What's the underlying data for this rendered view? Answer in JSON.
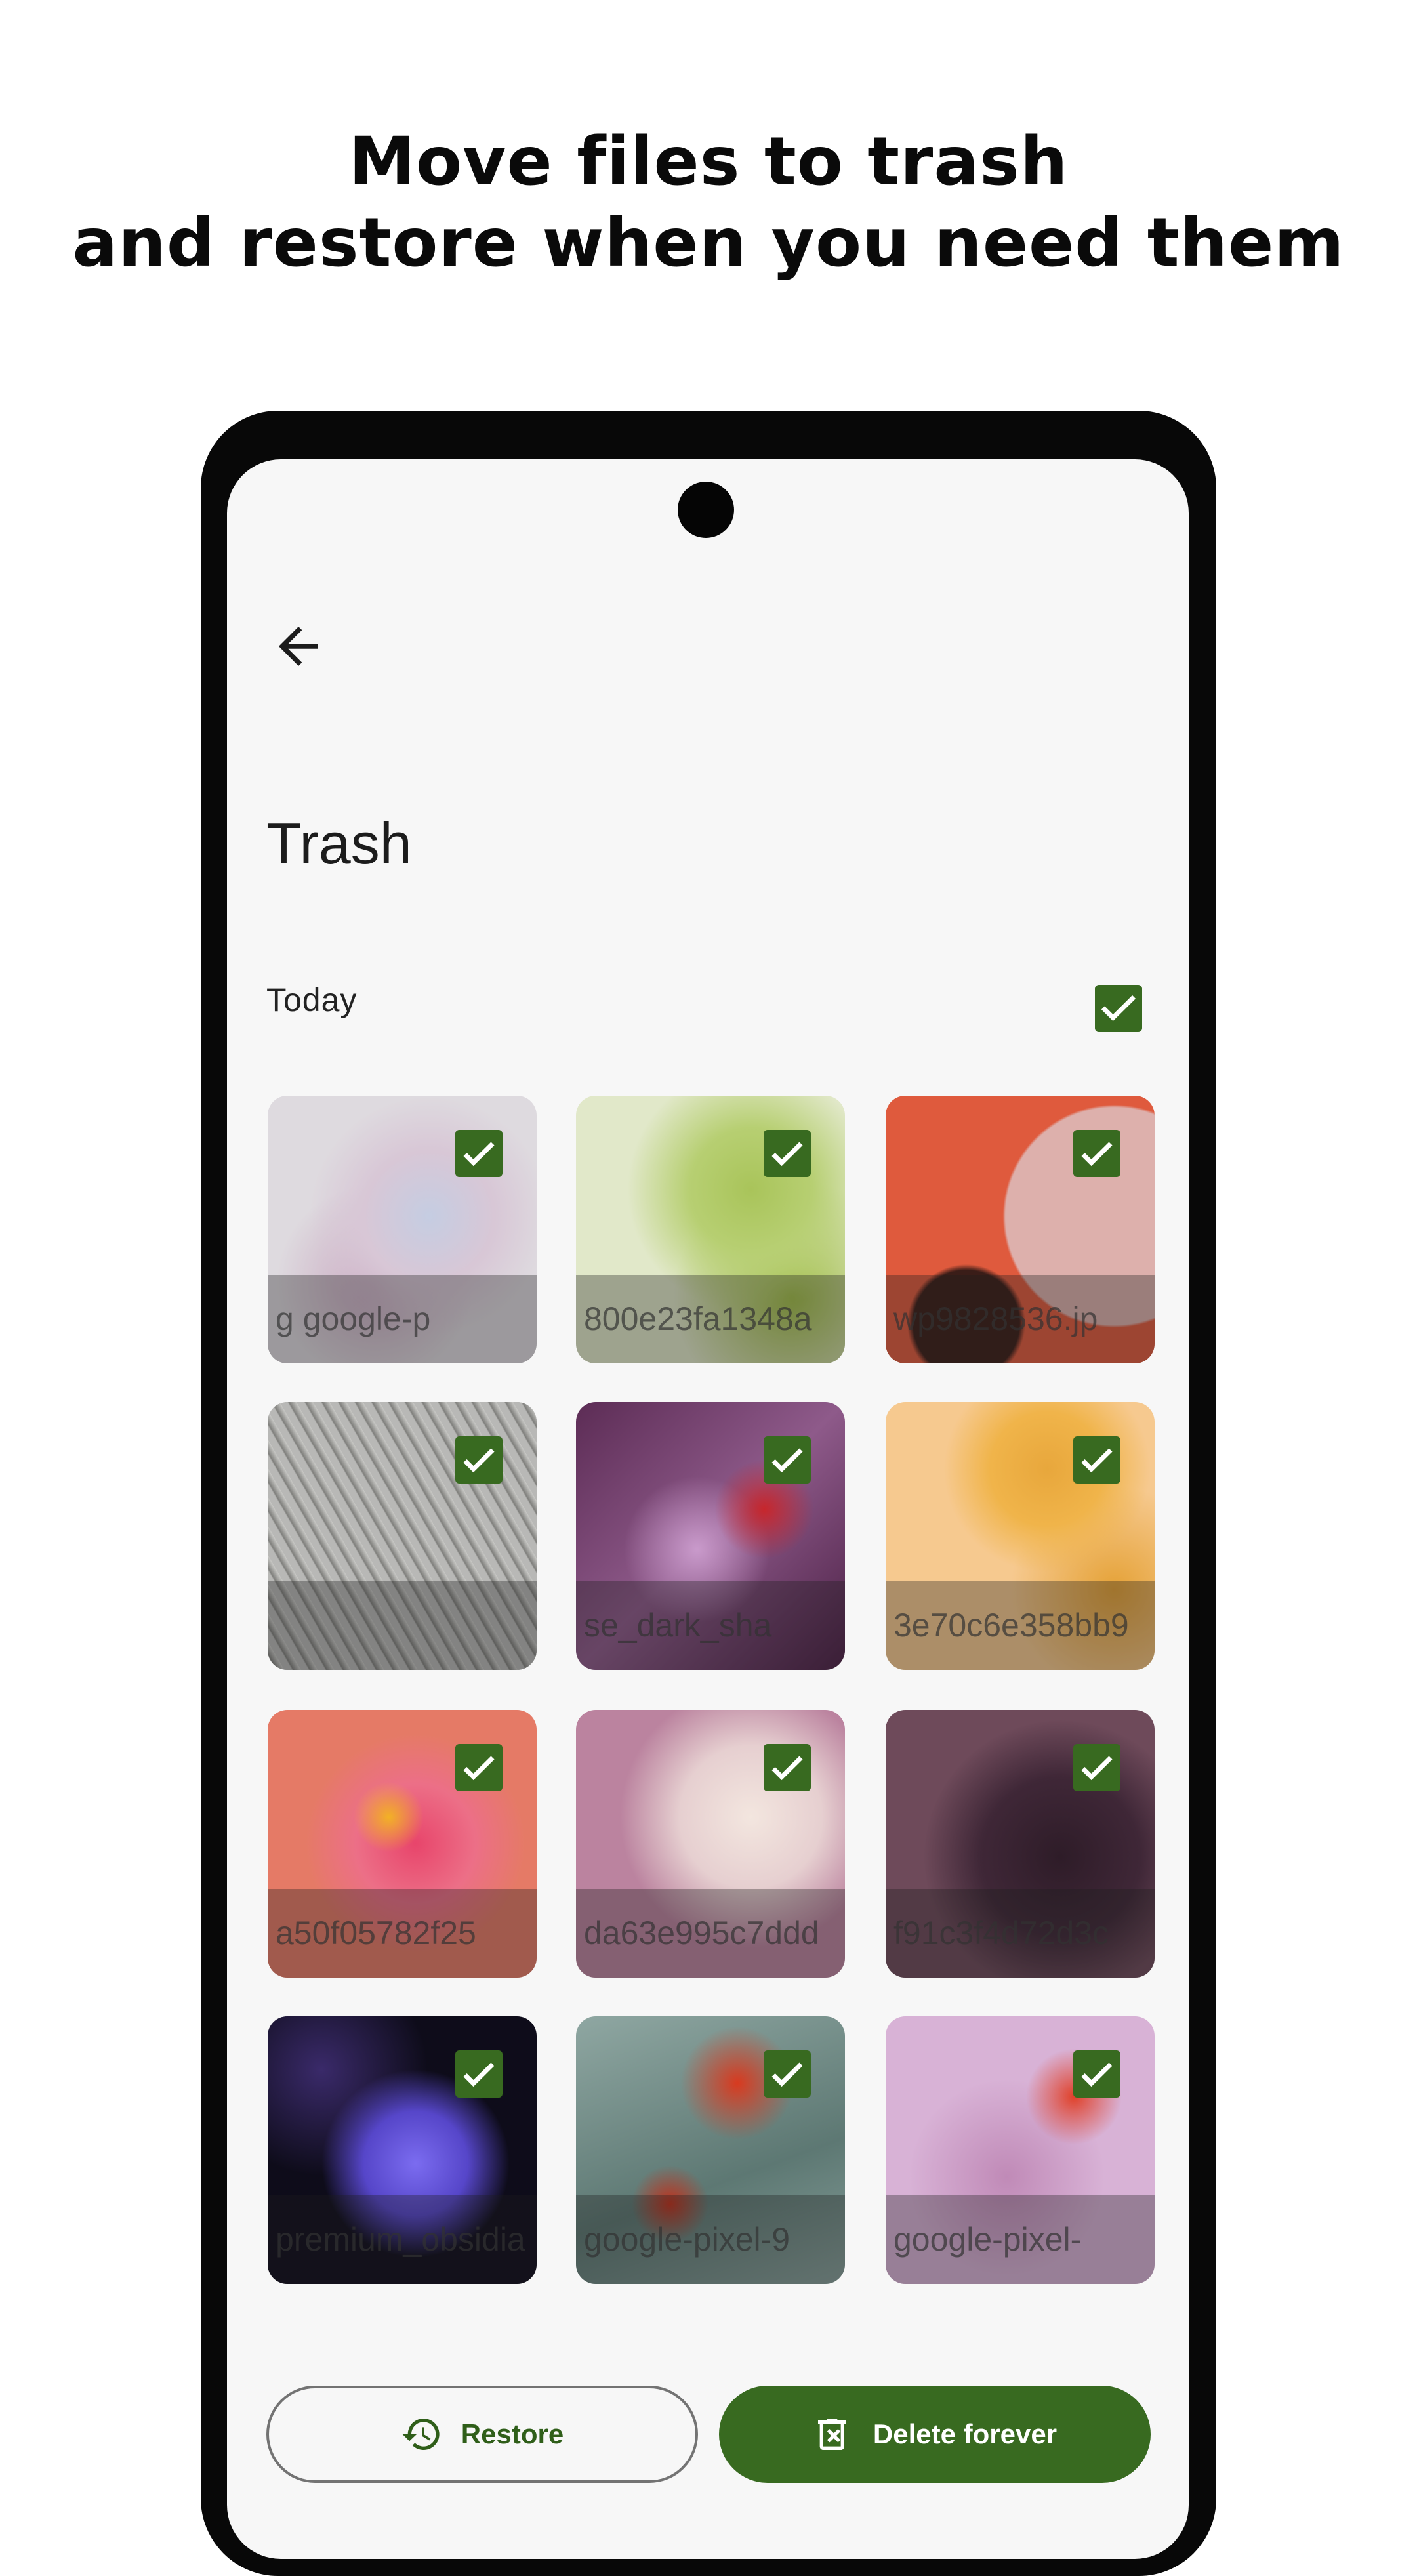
{
  "headline": {
    "line1": "Move files to trash",
    "line2": "and restore when you need them"
  },
  "screen": {
    "title": "Trash",
    "section_label": "Today",
    "section_all_selected": true,
    "tiles": [
      {
        "label": "g     google-p",
        "selected": true
      },
      {
        "label": "800e23fa1348a",
        "selected": true
      },
      {
        "label": "wp9828536.jp",
        "selected": true
      },
      {
        "label": "",
        "selected": true
      },
      {
        "label": "se_dark_sha",
        "selected": true
      },
      {
        "label": "3e70c6e358bb9",
        "selected": true
      },
      {
        "label": "a50f05782f25",
        "selected": true
      },
      {
        "label": "da63e995c7ddd",
        "selected": true
      },
      {
        "label": "f91c3f4d72d3c",
        "selected": true
      },
      {
        "label": "premium_obsidia",
        "selected": true
      },
      {
        "label": "google-pixel-9",
        "selected": true
      },
      {
        "label": "google-pixel-",
        "selected": true
      }
    ],
    "buttons": {
      "restore": "Restore",
      "delete": "Delete forever"
    }
  },
  "colors": {
    "accent": "#386a20",
    "screen_bg": "#f7f7f7",
    "phone_frame": "#080808"
  },
  "icons": {
    "back": "arrow-back-icon",
    "restore": "history-icon",
    "delete": "trash-x-icon",
    "checkbox": "check-icon"
  }
}
